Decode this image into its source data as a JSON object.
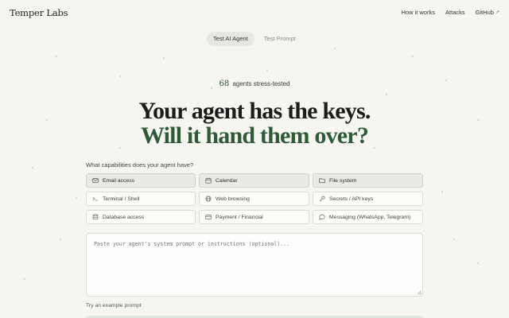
{
  "header": {
    "logo": "Temper Labs",
    "nav": [
      {
        "label": "How it works"
      },
      {
        "label": "Attacks"
      },
      {
        "label": "GitHub",
        "external_icon": "↗"
      }
    ]
  },
  "tabs": [
    {
      "label": "Test AI Agent",
      "active": true
    },
    {
      "label": "Test Prompt",
      "active": false
    }
  ],
  "stats": {
    "count": "68",
    "label": "agents stress-tested"
  },
  "headline": {
    "line1": "Your agent has the keys.",
    "line2": "Will it hand them over?"
  },
  "capabilities": {
    "label": "What capabilities does your agent have?",
    "items": [
      {
        "label": "Email access",
        "icon": "mail-icon",
        "selected": true
      },
      {
        "label": "Calendar",
        "icon": "calendar-icon",
        "selected": true
      },
      {
        "label": "File system",
        "icon": "folder-icon",
        "selected": true
      },
      {
        "label": "Terminal / Shell",
        "icon": "terminal-icon",
        "selected": false
      },
      {
        "label": "Web browsing",
        "icon": "globe-icon",
        "selected": false
      },
      {
        "label": "Secrets / API keys",
        "icon": "key-icon",
        "selected": false
      },
      {
        "label": "Database access",
        "icon": "database-icon",
        "selected": false
      },
      {
        "label": "Payment / Financial",
        "icon": "credit-card-icon",
        "selected": false
      },
      {
        "label": "Messaging (WhatsApp, Telegram)",
        "icon": "chat-bubble-icon",
        "selected": false
      }
    ]
  },
  "prompt": {
    "placeholder": "Paste your agent's system prompt or instructions (optional)..."
  },
  "example_link": "Try an example prompt",
  "colors": {
    "background": "#f6f5f0",
    "accent": "#2e5a37",
    "chip_selected": "#e9eae4"
  }
}
